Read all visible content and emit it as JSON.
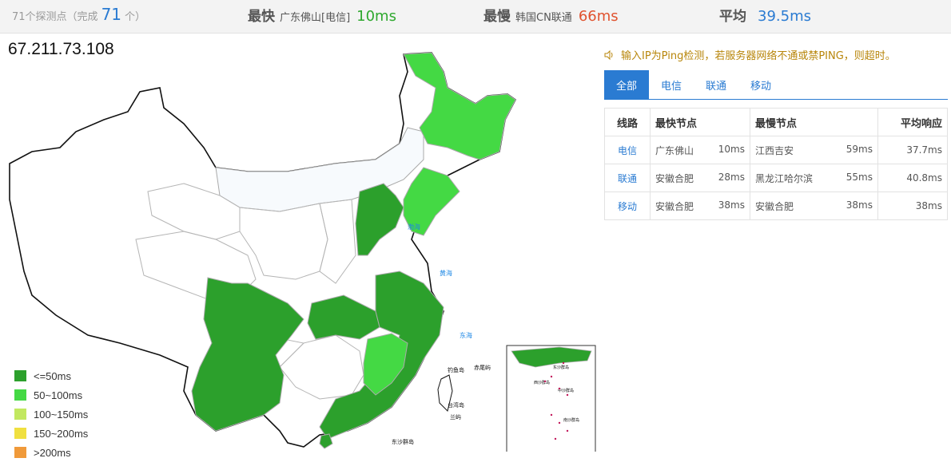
{
  "topbar": {
    "probe_count": "71个探测点",
    "done_prefix": "（完成",
    "done_count": "71",
    "done_suffix": "个）",
    "fastest_label": "最快",
    "fastest_node": "广东佛山[电信]",
    "fastest_ms": "10ms",
    "slowest_label": "最慢",
    "slowest_node": "韩国CN联通",
    "slowest_ms": "66ms",
    "average_label": "平均",
    "average_ms": "39.5ms"
  },
  "ip": "67.211.73.108",
  "notice": "输入IP为Ping检测，若服务器网络不通或禁PING，则超时。",
  "tabs": [
    "全部",
    "电信",
    "联通",
    "移动"
  ],
  "table": {
    "headers": [
      "线路",
      "最快节点",
      "最慢节点",
      "平均响应"
    ],
    "rows": [
      {
        "line": "电信",
        "fast_node": "广东佛山",
        "fast_ms": "10ms",
        "slow_node": "江西吉安",
        "slow_ms": "59ms",
        "avg": "37.7ms"
      },
      {
        "line": "联通",
        "fast_node": "安徽合肥",
        "fast_ms": "28ms",
        "slow_node": "黑龙江哈尔滨",
        "slow_ms": "55ms",
        "avg": "40.8ms"
      },
      {
        "line": "移动",
        "fast_node": "安徽合肥",
        "fast_ms": "38ms",
        "slow_node": "安徽合肥",
        "slow_ms": "38ms",
        "avg": "38ms"
      }
    ]
  },
  "legend": [
    {
      "label": "<=50ms",
      "color": "#2ca02c"
    },
    {
      "label": "50~100ms",
      "color": "#44d944"
    },
    {
      "label": "100~150ms",
      "color": "#c2e860"
    },
    {
      "label": "150~200ms",
      "color": "#f0e040"
    },
    {
      "label": ">200ms",
      "color": "#f09a3a"
    }
  ],
  "map": {
    "sea_labels": [
      "渤海",
      "黄海",
      "东海"
    ],
    "island_labels": [
      "台湾岛",
      "钓鱼岛",
      "赤尾屿",
      "东沙群岛",
      "兰屿"
    ],
    "inset_labels": [
      "东沙群岛",
      "西沙群岛",
      "中沙群岛",
      "南沙群岛"
    ],
    "colors": {
      "fast": "#2ca02c",
      "medium": "#44d944",
      "border": "#aaaaaa",
      "sea": "#1e88e5"
    }
  }
}
